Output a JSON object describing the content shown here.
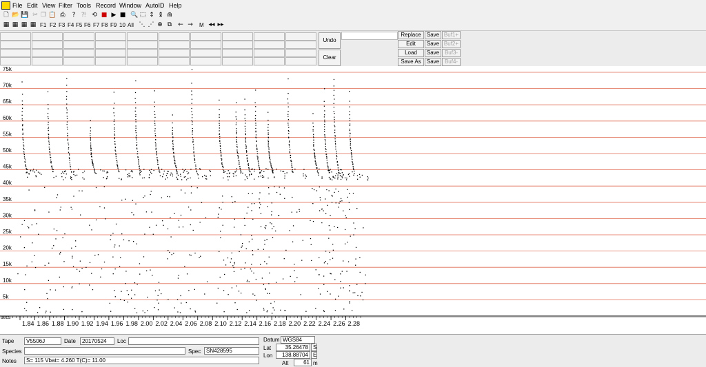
{
  "menu": [
    "File",
    "Edit",
    "View",
    "Filter",
    "Tools",
    "Record",
    "Window",
    "AutoID",
    "Help"
  ],
  "toolbar2": {
    "func_keys": [
      "F1",
      "F2",
      "F3",
      "F4",
      "F5",
      "F6",
      "F7",
      "F8",
      "F9",
      "10",
      "All"
    ],
    "marker": "M"
  },
  "panel": {
    "undo": "Undo",
    "clear": "Clear",
    "actions": [
      "Replace",
      "Edit",
      "Load",
      "Save As"
    ],
    "save_label": "Save",
    "bufs": [
      "Buf1+",
      "Buf2+",
      "Buf3-",
      "Buf4-"
    ]
  },
  "chart_data": {
    "type": "scatter",
    "xlabel": "secs",
    "x_ticks": [
      "1.84",
      "1.86",
      "1.88",
      "1.90",
      "1.92",
      "1.94",
      "1.96",
      "1.98",
      "2.00",
      "2.02",
      "2.04",
      "2.06",
      "2.08",
      "2.10",
      "2.12",
      "2.14",
      "2.16",
      "2.18",
      "2.20",
      "2.22",
      "2.24",
      "2.26",
      "2.28"
    ],
    "xlim": [
      1.833,
      2.296
    ],
    "y_ticks": [
      "5k",
      "10k",
      "15k",
      "20k",
      "25k",
      "30k",
      "35k",
      "40k",
      "45k",
      "50k",
      "55k",
      "60k",
      "65k",
      "70k",
      "75k"
    ],
    "ylim": [
      0,
      80
    ],
    "grid": true,
    "grid_color": "#e06a50",
    "dot_color": "#000000",
    "call_starts": [
      1.842,
      1.877,
      1.902,
      1.934,
      1.966,
      1.995,
      2.021,
      2.045,
      2.071,
      2.108,
      2.131,
      2.143,
      2.157,
      2.174,
      2.201,
      2.235,
      2.25,
      2.263,
      2.284
    ]
  },
  "status": {
    "tape_label": "Tape",
    "tape": "V5506J",
    "date_label": "Date",
    "date": "20170524",
    "loc_label": "Loc",
    "loc": "",
    "species_label": "Species",
    "species": "",
    "spec_label": "Spec",
    "spec": "SN428595",
    "notes_label": "Notes",
    "notes": "S= 115  Vbat=  4.260  T(C)=  11.00",
    "datum_label": "Datum",
    "datum": "WGS84",
    "lat_label": "Lat",
    "lat": "35.26478",
    "lat_hem": "S",
    "lon_label": "Lon",
    "lon": "138.88704",
    "lon_hem": "E",
    "alt_label": "Alt",
    "alt": "61",
    "alt_unit": "m"
  }
}
